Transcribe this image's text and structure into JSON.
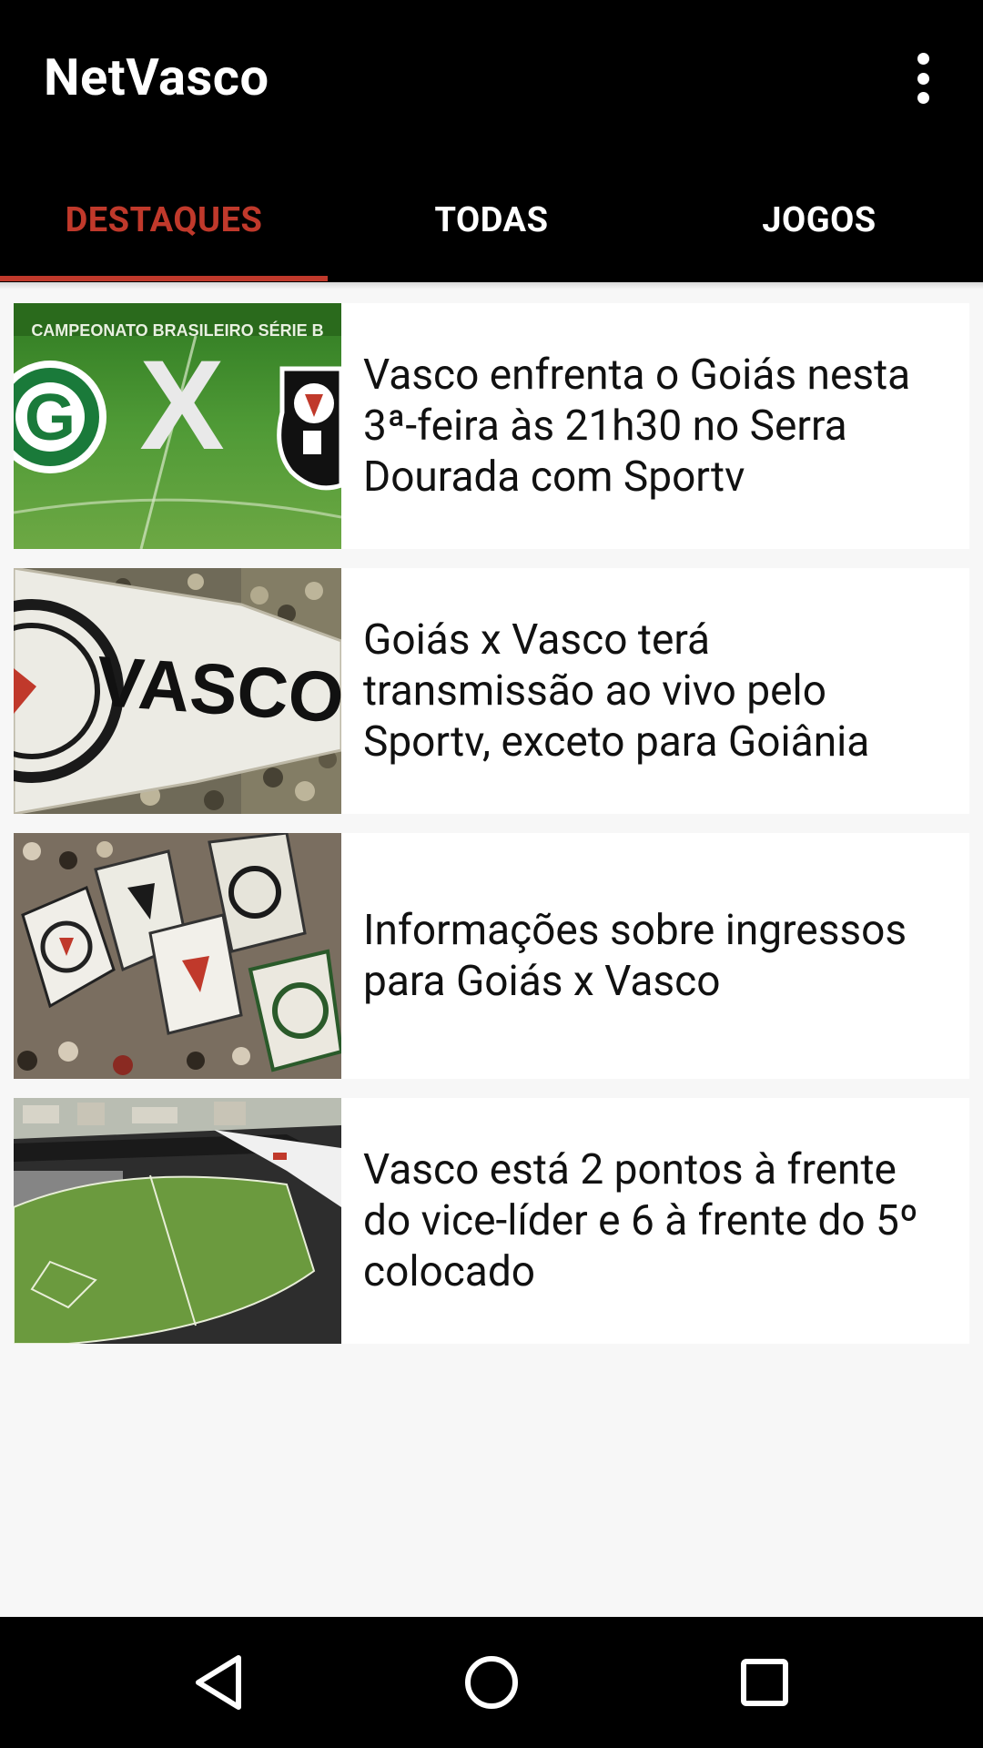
{
  "app": {
    "title": "NetVasco"
  },
  "tabs": [
    {
      "label": "DESTAQUES",
      "active": true
    },
    {
      "label": "TODAS",
      "active": false
    },
    {
      "label": "JOGOS",
      "active": false
    }
  ],
  "colors": {
    "accent": "#c0392b",
    "appbar": "#000000",
    "background": "#f7f7f7"
  },
  "news": [
    {
      "title": "Vasco enfrenta o Goiás nesta 3ª-feira às 21h30 no Serra Dourada com Sportv",
      "image": "goias-x-vasco-graphic",
      "image_text": "CAMPEONATO BRASILEIRO SÉRIE B"
    },
    {
      "title": "Goiás x Vasco terá transmissão ao vivo pelo Sportv, exceto para Goiânia",
      "image": "vasco-fans-flag-photo",
      "image_text": "VASCO"
    },
    {
      "title": "Informações sobre ingressos para Goiás x Vasco",
      "image": "fans-waving-flags-photo"
    },
    {
      "title": "Vasco está 2 pontos à frente do vice-líder e 6 à frente do 5º colocado",
      "image": "stadium-aerial-photo"
    }
  ],
  "navbar": {
    "icons": [
      "back-icon",
      "home-icon",
      "recents-icon"
    ]
  }
}
